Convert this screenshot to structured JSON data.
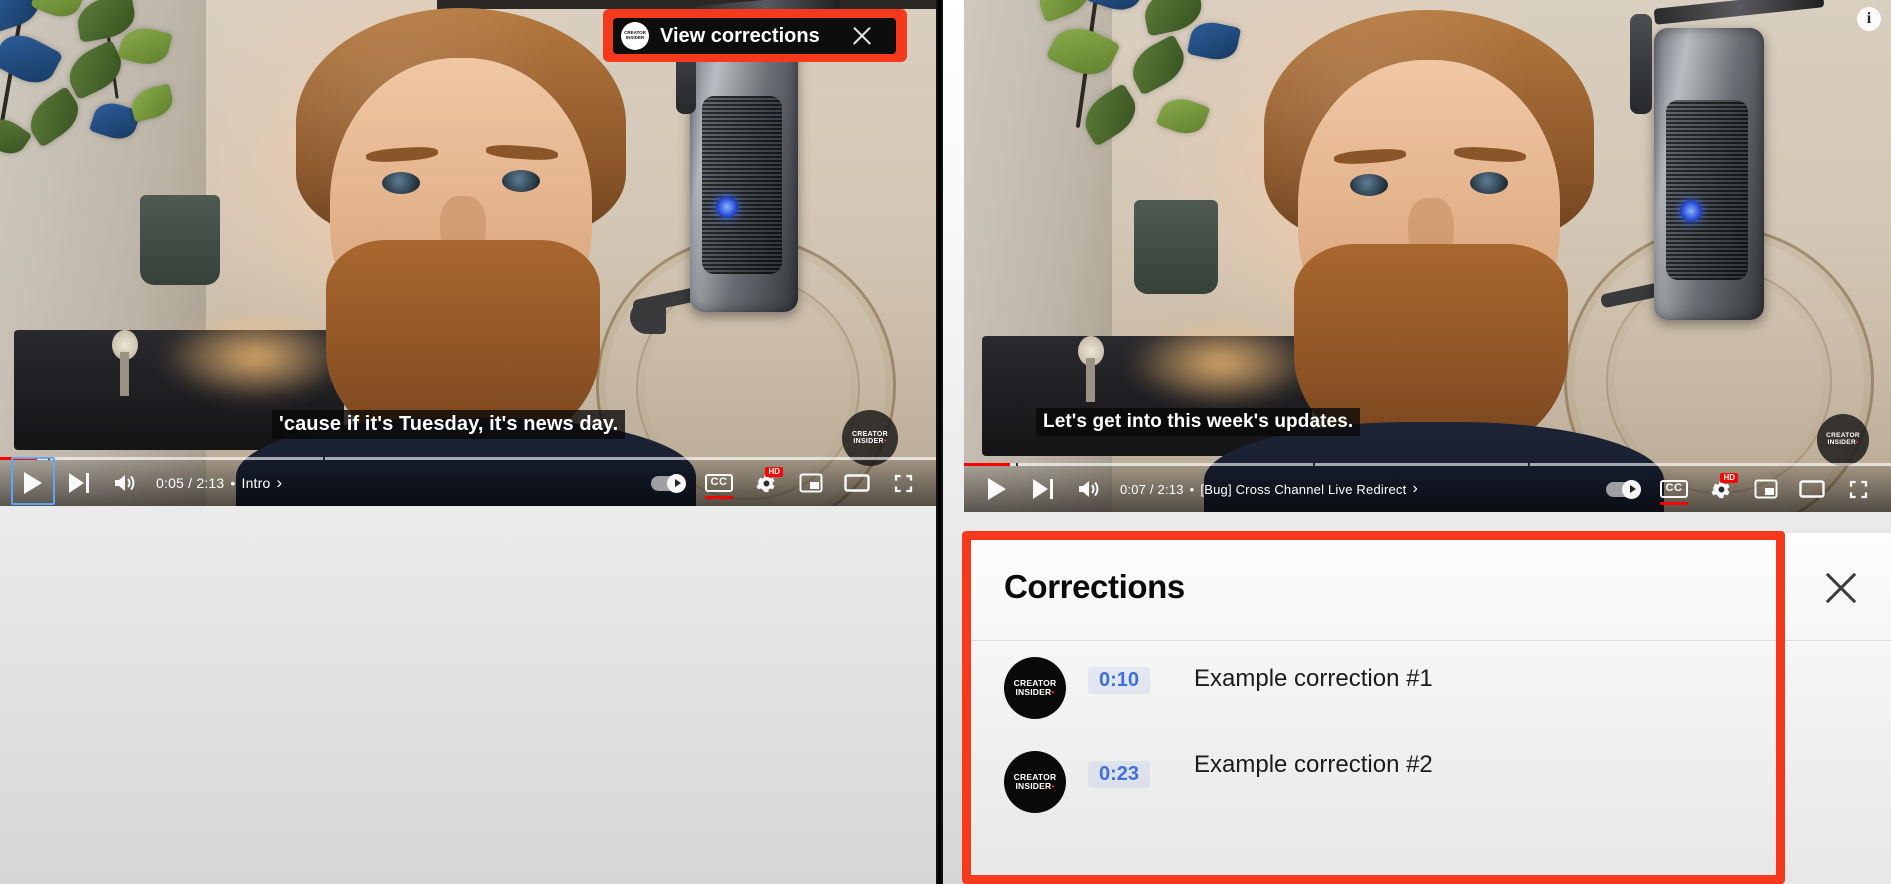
{
  "left_panel": {
    "banner": {
      "label": "View corrections",
      "avatar_line1": "CREATOR",
      "avatar_line2": "INSIDER",
      "close_icon": "close-icon",
      "highlight_color": "#f4391c"
    },
    "caption": "'cause if it's Tuesday, it's news day.",
    "watermark_line1": "CREATOR",
    "watermark_line2": "INSIDER",
    "player": {
      "play_icon": "play-icon",
      "next_icon": "next-video-icon",
      "volume_icon": "volume-icon",
      "time": "0:05 / 2:13",
      "separator": "•",
      "chapter": "Intro",
      "chapter_arrow": "›",
      "autoplay_icon": "autoplay-toggle-icon",
      "cc_label": "CC",
      "settings_icon": "gear-icon",
      "settings_badge": "HD",
      "miniplayer_icon": "miniplayer-icon",
      "theater_icon": "theater-mode-icon",
      "fullscreen_icon": "fullscreen-icon",
      "progress_percent": 4
    }
  },
  "right_panel": {
    "info_icon": "info-icon",
    "info_glyph": "i",
    "caption": "Let's get into this week's updates.",
    "watermark_line1": "CREATOR",
    "watermark_line2": "INSIDER",
    "player": {
      "play_icon": "play-icon",
      "next_icon": "next-video-icon",
      "volume_icon": "volume-icon",
      "time": "0:07 / 2:13",
      "separator": "•",
      "chapter": "[Bug] Cross Channel Live Redirect",
      "chapter_arrow": "›",
      "autoplay_icon": "autoplay-toggle-icon",
      "cc_label": "CC",
      "settings_icon": "gear-icon",
      "settings_badge": "HD",
      "miniplayer_icon": "miniplayer-icon",
      "theater_icon": "theater-mode-icon",
      "fullscreen_icon": "fullscreen-icon",
      "progress_percent": 5
    },
    "corrections": {
      "title": "Corrections",
      "close_icon": "close-icon",
      "highlight_color": "#f4391c",
      "items": [
        {
          "time": "0:10",
          "text": "Example correction #1",
          "avatar_line1": "CREATOR",
          "avatar_line2": "INSIDER"
        },
        {
          "time": "0:23",
          "text": "Example correction #2",
          "avatar_line1": "CREATOR",
          "avatar_line2": "INSIDER"
        }
      ]
    }
  }
}
